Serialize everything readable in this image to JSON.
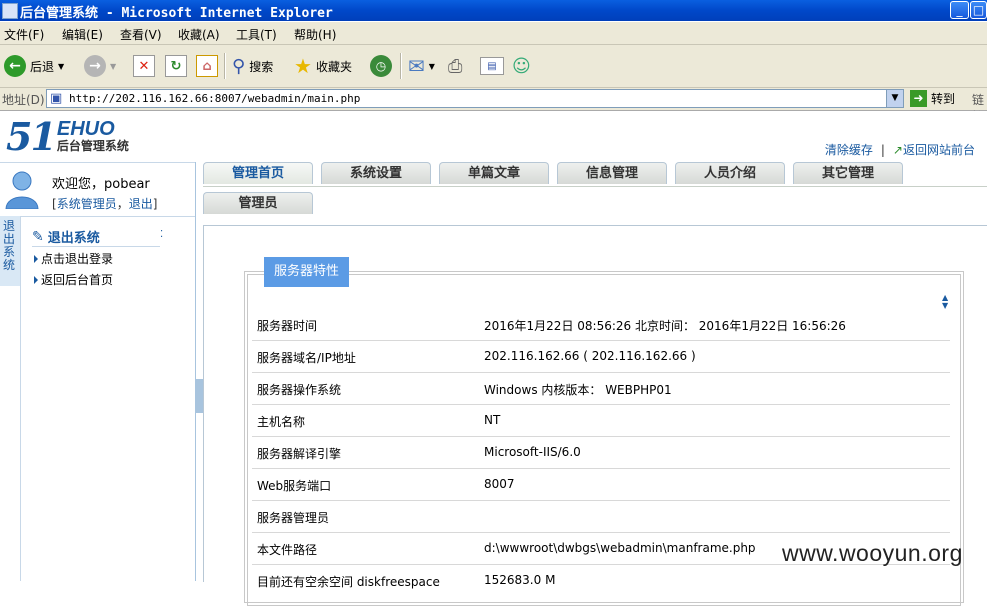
{
  "window": {
    "title": "后台管理系统 - Microsoft Internet Explorer"
  },
  "menubar": [
    "文件(F)",
    "编辑(E)",
    "查看(V)",
    "收藏(A)",
    "工具(T)",
    "帮助(H)"
  ],
  "toolbar": {
    "back": "后退",
    "search": "搜索",
    "favorites": "收藏夹"
  },
  "address": {
    "label": "地址(D)",
    "url": "http://202.116.162.66:8007/webadmin/main.php",
    "go": "转到",
    "links": "链接"
  },
  "logo": {
    "number": "51",
    "brand": "EHUO",
    "subtitle": "后台管理系统"
  },
  "toplinks": {
    "clear_cache": "清除缓存",
    "sep": "|",
    "back_front": "返回网站前台"
  },
  "user": {
    "welcome": "欢迎您，pobear",
    "role_open": "[",
    "role": "系统管理员",
    "comma": "，",
    "logout": "退出",
    "role_close": "]"
  },
  "sidetab": {
    "label": "退出系统"
  },
  "leftmenu": {
    "heading": "退出系统",
    "items": [
      "点击退出登录",
      "返回后台首页"
    ]
  },
  "tabs": [
    "管理首页",
    "系统设置",
    "单篇文章",
    "信息管理",
    "人员介绍",
    "其它管理"
  ],
  "tabs_row2": [
    "管理员"
  ],
  "panel": {
    "legend": "服务器特性",
    "rows": [
      {
        "k": "服务器时间",
        "v": "2016年1月22日 08:56:26 北京时间： 2016年1月22日 16:56:26"
      },
      {
        "k": "服务器域名/IP地址",
        "v": "202.116.162.66 ( 202.116.162.66 )"
      },
      {
        "k": "服务器操作系统",
        "v": "Windows 内核版本： WEBPHP01"
      },
      {
        "k": "主机名称",
        "v": "NT"
      },
      {
        "k": "服务器解译引擎",
        "v": "Microsoft-IIS/6.0"
      },
      {
        "k": "Web服务端口",
        "v": "8007"
      },
      {
        "k": "服务器管理员",
        "v": ""
      },
      {
        "k": "本文件路径",
        "v": "d:\\wwwroot\\dwbgs\\webadmin\\manframe.php"
      },
      {
        "k": "目前还有空余空间 diskfreespace",
        "v": "152683.0 M"
      }
    ]
  },
  "watermark": "www.wooyun.org",
  "colors": {
    "accent": "#1a5aa0",
    "legend": "#5b9be5",
    "titlebar": "#0a5fe0"
  }
}
